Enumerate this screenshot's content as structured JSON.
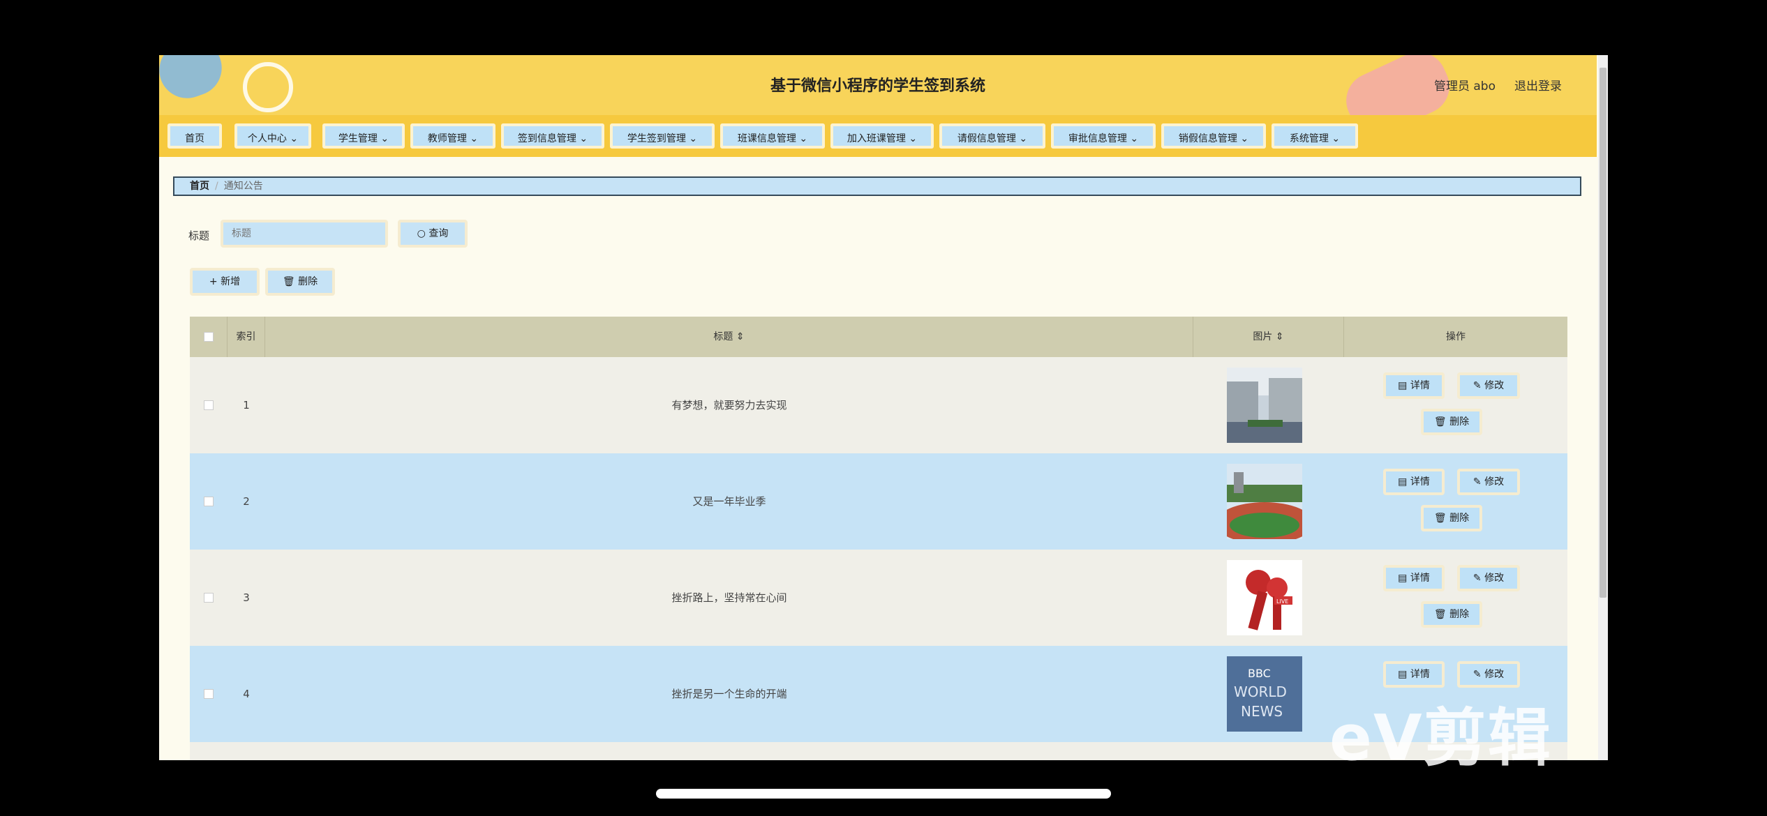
{
  "header": {
    "title": "基于微信小程序的学生签到系统",
    "user": "管理员 abo",
    "logout": "退出登录"
  },
  "nav": [
    {
      "label": "首页"
    },
    {
      "label": "个人中心 ⌄"
    },
    {
      "label": "学生管理 ⌄"
    },
    {
      "label": "教师管理 ⌄"
    },
    {
      "label": "签到信息管理 ⌄"
    },
    {
      "label": "学生签到管理 ⌄"
    },
    {
      "label": "班课信息管理 ⌄"
    },
    {
      "label": "加入班课管理 ⌄"
    },
    {
      "label": "请假信息管理 ⌄"
    },
    {
      "label": "审批信息管理 ⌄"
    },
    {
      "label": "销假信息管理 ⌄"
    },
    {
      "label": "系统管理 ⌄"
    }
  ],
  "breadcrumb": {
    "home": "首页",
    "current": "通知公告"
  },
  "search": {
    "label": "标题",
    "placeholder": "标题",
    "button": "查询"
  },
  "toolbar": {
    "add": "+ 新增",
    "delete": "删除"
  },
  "table": {
    "headers": {
      "index": "索引",
      "title": "标题 ⇕",
      "image": "图片 ⇕",
      "ops": "操作"
    },
    "rows": [
      {
        "index": "1",
        "title": "有梦想，就要努力去实现"
      },
      {
        "index": "2",
        "title": "又是一年毕业季"
      },
      {
        "index": "3",
        "title": "挫折路上，坚持常在心间"
      },
      {
        "index": "4",
        "title": "挫折是另一个生命的开端"
      }
    ],
    "actions": {
      "detail": "详情",
      "edit": "修改",
      "delete": "删除"
    }
  },
  "thumb_texts": {
    "live": "LIVE",
    "bbc": "BBC",
    "world": "WORLD",
    "news": "NEWS"
  },
  "watermark": "eV剪辑",
  "colors": {
    "header": "#f8d45a",
    "nav": "#f6c93e",
    "button": "#bfe1f7",
    "row_alt": "#c6e3f6",
    "row": "#f0efe8"
  }
}
